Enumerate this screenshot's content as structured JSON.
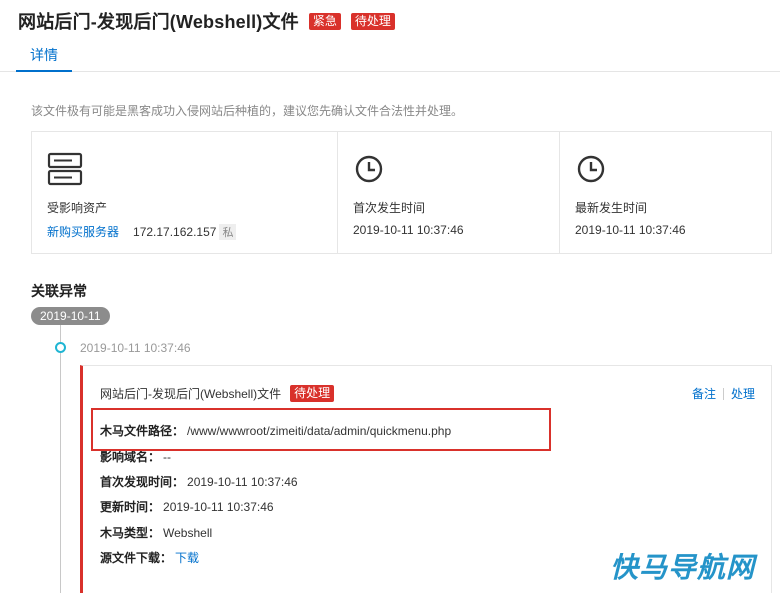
{
  "header": {
    "title": "网站后门-发现后门(Webshell)文件",
    "badge_urgent": "紧急",
    "badge_status": "待处理"
  },
  "tabs": [
    {
      "label": "详情"
    }
  ],
  "notice": "该文件极有可能是黑客成功入侵网站后种植的，建议您先确认文件合法性并处理。",
  "info": {
    "asset": {
      "icon": "server-icon",
      "label": "受影响资产",
      "link": "新购买服务器",
      "ip": "172.17.162.157",
      "tag": "私"
    },
    "first_time": {
      "icon": "clock-icon",
      "label": "首次发生时间",
      "value": "2019-10-11 10:37:46"
    },
    "latest_time": {
      "icon": "clock-icon",
      "label": "最新发生时间",
      "value": "2019-10-11 10:37:46"
    }
  },
  "related": {
    "title": "关联异常",
    "date": "2019-10-11",
    "timeline_time": "2019-10-11 10:37:46",
    "card": {
      "title": "网站后门-发现后门(Webshell)文件",
      "badge": "待处理",
      "actions": [
        "备注",
        "处理"
      ],
      "details": [
        {
          "label": "木马文件路径：",
          "value": "/www/wwwroot/zimeiti/data/admin/quickmenu.php"
        },
        {
          "label": "影响域名：",
          "value": "--"
        },
        {
          "label": "首次发现时间：",
          "value": "2019-10-11 10:37:46"
        },
        {
          "label": "更新时间：",
          "value": "2019-10-11 10:37:46"
        },
        {
          "label": "木马类型：",
          "value": "Webshell"
        },
        {
          "label": "源文件下载：",
          "value": "下载"
        }
      ]
    }
  },
  "watermark": "快马导航网",
  "colors": {
    "accent": "#0070cc",
    "danger": "#d9312b",
    "timeline_dot": "#1fb5d3",
    "watermark": "#2594c9"
  }
}
